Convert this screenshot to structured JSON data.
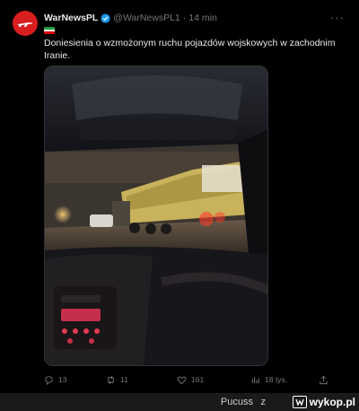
{
  "account": {
    "name": "WarNewsPL",
    "handle": "@WarNewsPL1",
    "separator": "·",
    "time": "14 min",
    "more": "···",
    "flag_colors": [
      "#239f40",
      "#ffffff",
      "#da0000"
    ]
  },
  "tweet": {
    "text": "Doniesienia o wzmożonym ruchu pojazdów wojskowych w zachodnim Iranie."
  },
  "actions": {
    "replies": "13",
    "reposts": "11",
    "likes": "161",
    "views": "18 tys."
  },
  "watermark": {
    "user": "Pucuss",
    "z": "z",
    "site": "wykop.pl"
  },
  "colors": {
    "accent": "#1d9bf0",
    "muted": "#71767b",
    "avatar_bg": "#d81e1e"
  }
}
